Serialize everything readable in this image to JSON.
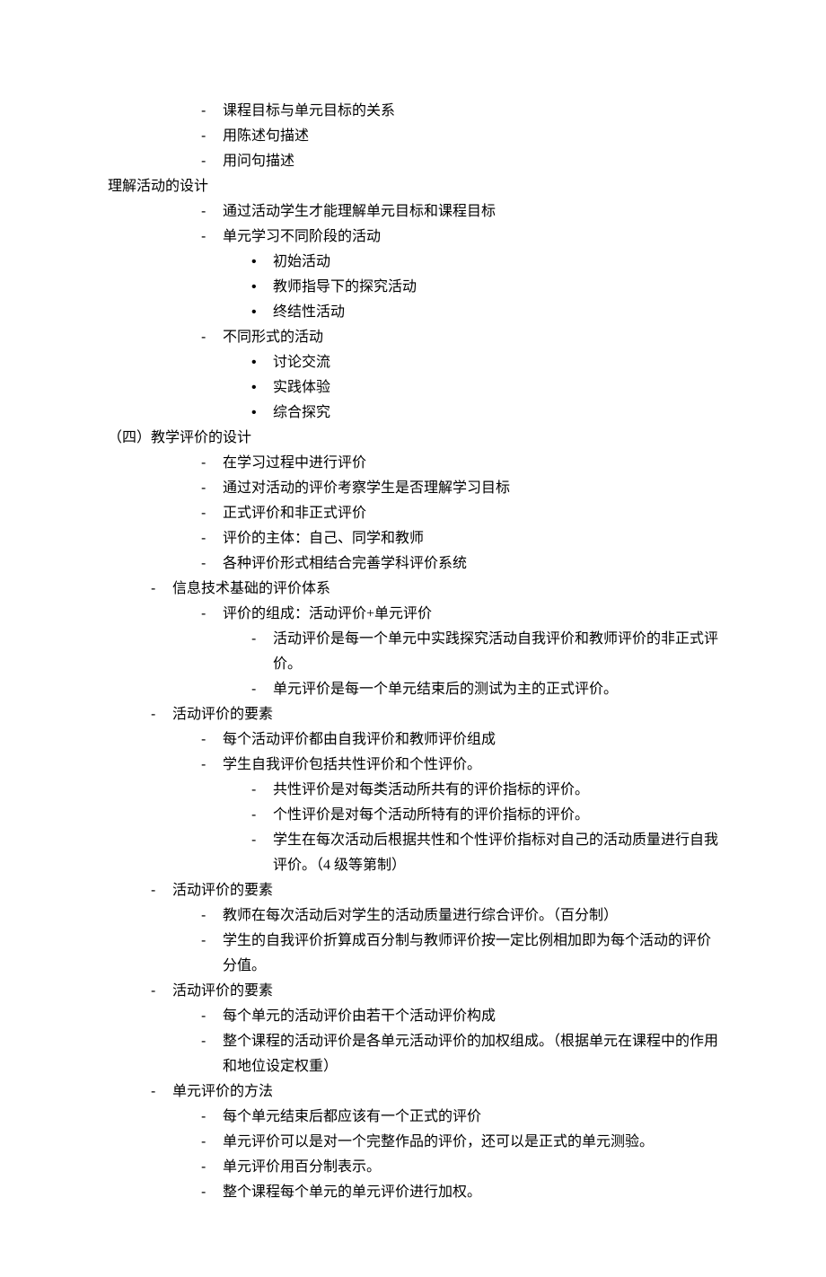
{
  "lines": [
    {
      "indent": "pad2",
      "bullet": "dash",
      "text": "课程目标与单元目标的关系"
    },
    {
      "indent": "pad2",
      "bullet": "dash",
      "text": "用陈述句描述"
    },
    {
      "indent": "pad2",
      "bullet": "dash",
      "text": "用问句描述"
    },
    {
      "indent": "pad0",
      "bullet": "plain",
      "text": "理解活动的设计"
    },
    {
      "indent": "pad2",
      "bullet": "dash",
      "text": "通过活动学生才能理解单元目标和课程目标"
    },
    {
      "indent": "pad2",
      "bullet": "dash",
      "text": "单元学习不同阶段的活动"
    },
    {
      "indent": "pad3",
      "bullet": "dot",
      "text": "初始活动"
    },
    {
      "indent": "pad3",
      "bullet": "dot",
      "text": "教师指导下的探究活动"
    },
    {
      "indent": "pad3",
      "bullet": "dot",
      "text": "终结性活动"
    },
    {
      "indent": "pad2",
      "bullet": "dash",
      "text": "不同形式的活动"
    },
    {
      "indent": "pad3",
      "bullet": "dot",
      "text": "讨论交流"
    },
    {
      "indent": "pad3",
      "bullet": "dot",
      "text": "实践体验"
    },
    {
      "indent": "pad3",
      "bullet": "dot",
      "text": "综合探究"
    },
    {
      "indent": "pad0",
      "bullet": "plain",
      "text": "（四）教学评价的设计"
    },
    {
      "indent": "pad2",
      "bullet": "dash",
      "text": "在学习过程中进行评价"
    },
    {
      "indent": "pad2",
      "bullet": "dash",
      "text": "通过对活动的评价考察学生是否理解学习目标"
    },
    {
      "indent": "pad2",
      "bullet": "dash",
      "text": "正式评价和非正式评价"
    },
    {
      "indent": "pad2",
      "bullet": "dash",
      "text": "评价的主体：自己、同学和教师"
    },
    {
      "indent": "pad2",
      "bullet": "dash",
      "text": "各种评价形式相结合完善学科评价系统"
    },
    {
      "indent": "pad1",
      "bullet": "dash",
      "text": "信息技术基础的评价体系"
    },
    {
      "indent": "pad2",
      "bullet": "dash",
      "text": "评价的组成：活动评价+单元评价"
    },
    {
      "indent": "pad3",
      "bullet": "dash",
      "text": "活动评价是每一个单元中实践探究活动自我评价和教师评价的非正式评价。"
    },
    {
      "indent": "pad3",
      "bullet": "dash",
      "text": "单元评价是每一个单元结束后的测试为主的正式评价。"
    },
    {
      "indent": "pad1",
      "bullet": "dash",
      "text": "活动评价的要素"
    },
    {
      "indent": "pad2",
      "bullet": "dash",
      "text": "每个活动评价都由自我评价和教师评价组成"
    },
    {
      "indent": "pad2",
      "bullet": "dash",
      "text": "学生自我评价包括共性评价和个性评价。"
    },
    {
      "indent": "pad3",
      "bullet": "dash",
      "text": "共性评价是对每类活动所共有的评价指标的评价。"
    },
    {
      "indent": "pad3",
      "bullet": "dash",
      "text": "个性评价是对每个活动所特有的评价指标的评价。"
    },
    {
      "indent": "pad3",
      "bullet": "dash",
      "text": "学生在每次活动后根据共性和个性评价指标对自己的活动质量进行自我评价。（4 级等第制）"
    },
    {
      "indent": "pad1",
      "bullet": "dash",
      "text": "活动评价的要素"
    },
    {
      "indent": "pad2",
      "bullet": "dash",
      "text": "教师在每次活动后对学生的活动质量进行综合评价。（百分制）"
    },
    {
      "indent": "pad2",
      "bullet": "dash",
      "text": "学生的自我评价折算成百分制与教师评价按一定比例相加即为每个活动的评价分值。"
    },
    {
      "indent": "pad1",
      "bullet": "dash",
      "text": "活动评价的要素"
    },
    {
      "indent": "pad2",
      "bullet": "dash",
      "text": "每个单元的活动评价由若干个活动评价构成"
    },
    {
      "indent": "pad2",
      "bullet": "dash",
      "text": "整个课程的活动评价是各单元活动评价的加权组成。（根据单元在课程中的作用和地位设定权重）"
    },
    {
      "indent": "pad1",
      "bullet": "dash",
      "text": "单元评价的方法"
    },
    {
      "indent": "pad2",
      "bullet": "dash",
      "text": "每个单元结束后都应该有一个正式的评价"
    },
    {
      "indent": "pad2",
      "bullet": "dash",
      "text": "单元评价可以是对一个完整作品的评价，还可以是正式的单元测验。"
    },
    {
      "indent": "pad2",
      "bullet": "dash",
      "text": "单元评价用百分制表示。"
    },
    {
      "indent": "pad2",
      "bullet": "dash",
      "text": "整个课程每个单元的单元评价进行加权。"
    }
  ]
}
